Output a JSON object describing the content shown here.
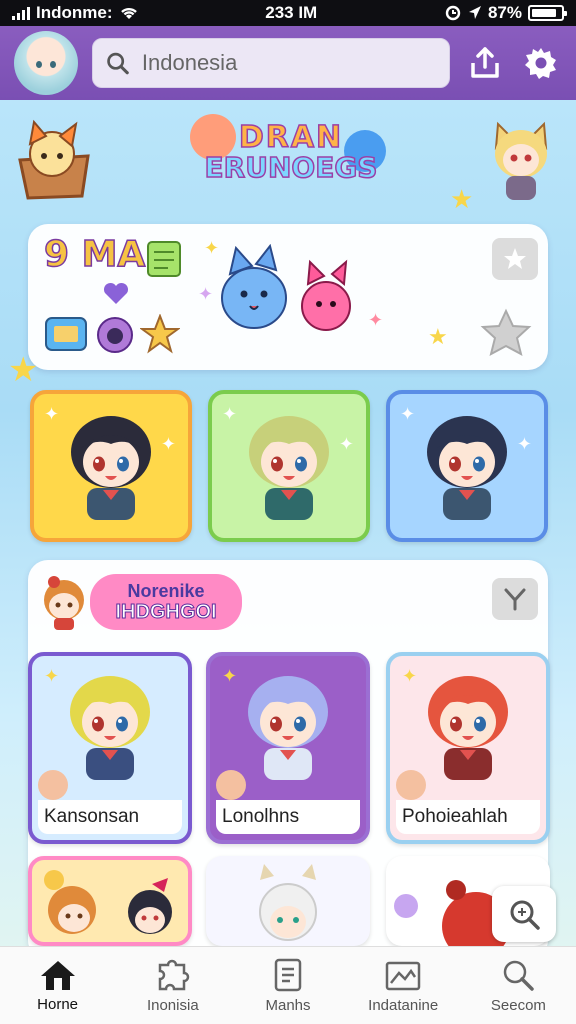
{
  "status_bar": {
    "carrier": "Indonme:",
    "time": "233 IM",
    "battery": "87%",
    "battery_level": 0.87
  },
  "search": {
    "value": "Indonesia"
  },
  "header": {
    "logo_line1": "DRAN",
    "logo_line2": "ERUNOEGS"
  },
  "featured": {
    "stickers_text": "9 MA",
    "tiles": [
      {
        "bg": "#ffd84a",
        "border": "#f6a53a",
        "hair": "#2b2b3a",
        "body": "#3c5670"
      },
      {
        "bg": "#c8f3a6",
        "border": "#7bcc4d",
        "hair": "#c7d07a",
        "body": "#2f6a6a"
      },
      {
        "bg": "#a6d5ff",
        "border": "#5a8de6",
        "hair": "#2b3450",
        "body": "#3c5670"
      }
    ]
  },
  "section": {
    "banner_line1": "Norenike",
    "banner_line2": "IHDGHGOI",
    "cards": [
      {
        "label": "Kansonsan",
        "bg": "#d6ecff",
        "border": "#7a5ad0",
        "hair": "#e3d84a",
        "body": "#3a4f80"
      },
      {
        "label": "Lonolhns",
        "bg": "#9b5fc8",
        "border": "#9b6fd3",
        "hair": "#a6b0f0",
        "body": "#dfe7f6"
      },
      {
        "label": "Pohoieahlah",
        "bg": "#fde6ea",
        "border": "#9ad0f0",
        "hair": "#e5553e",
        "body": "#8a2d2d"
      }
    ]
  },
  "bottom_nav": [
    {
      "label": "Horne",
      "icon": "home-icon",
      "active": true
    },
    {
      "label": "Inonisia",
      "icon": "puzzle-icon",
      "active": false
    },
    {
      "label": "Manhs",
      "icon": "book-icon",
      "active": false
    },
    {
      "label": "Indatanine",
      "icon": "map-icon",
      "active": false
    },
    {
      "label": "Seecom",
      "icon": "search-icon",
      "active": false
    }
  ]
}
